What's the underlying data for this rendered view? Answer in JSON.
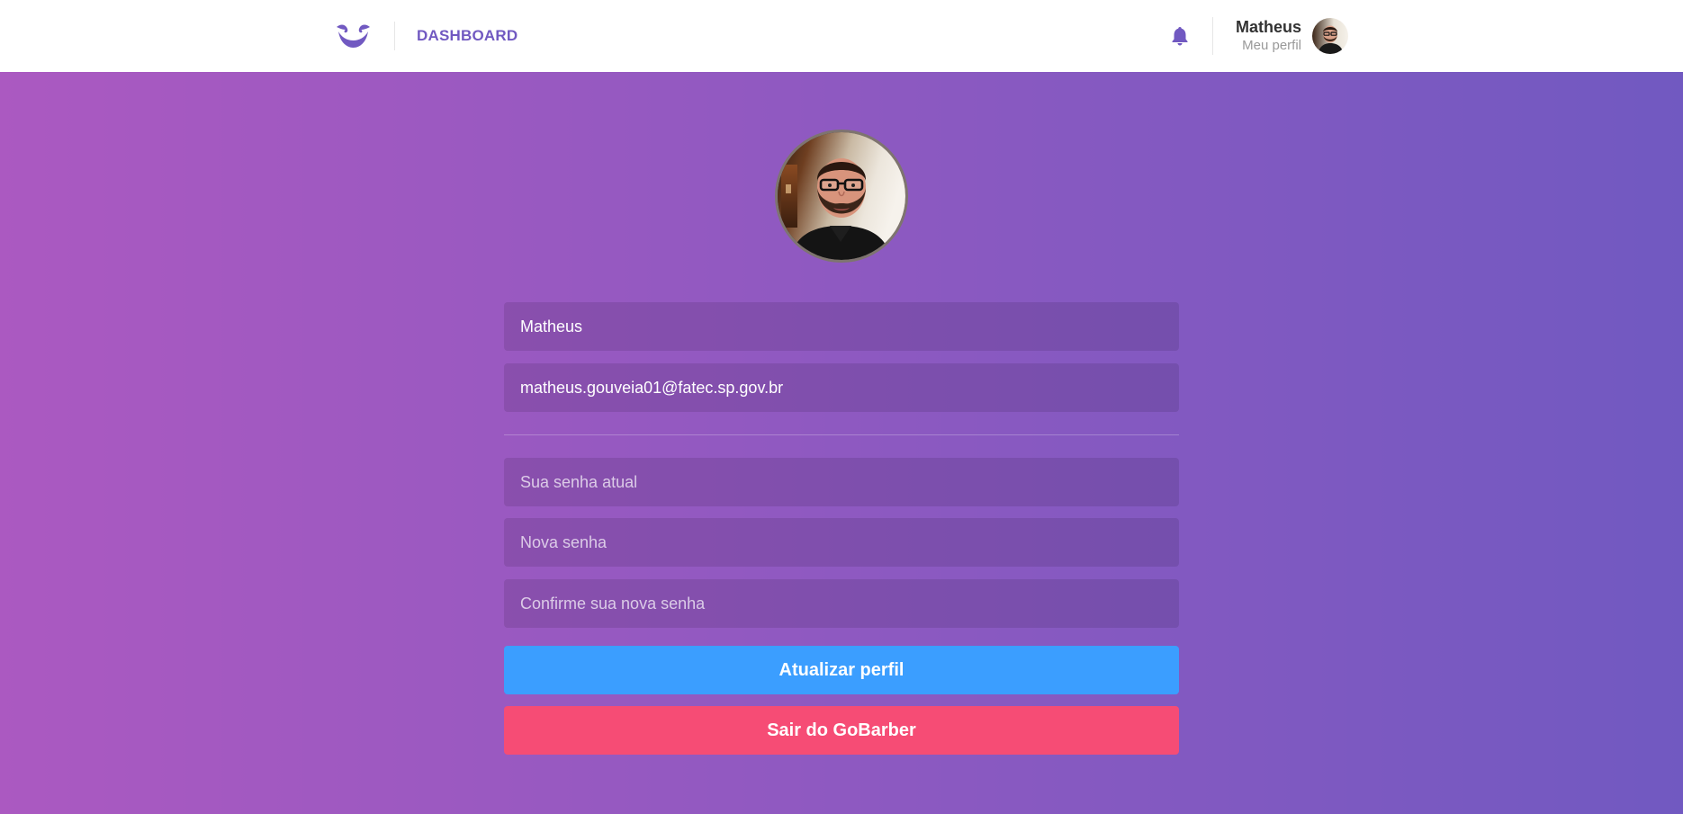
{
  "header": {
    "logo_icon": "gobarber-mustache-logo-icon",
    "nav_dashboard": "DASHBOARD",
    "notifications_icon": "bell-icon",
    "profile_name": "Matheus",
    "profile_link": "Meu perfil"
  },
  "profile_form": {
    "name_value": "Matheus",
    "email_value": "matheus.gouveia01@fatec.sp.gov.br",
    "old_password_placeholder": "Sua senha atual",
    "new_password_placeholder": "Nova senha",
    "confirm_password_placeholder": "Confirme sua nova senha",
    "submit_label": "Atualizar perfil",
    "logout_label": "Sair do GoBarber"
  },
  "colors": {
    "brand": "#7159c1",
    "gradient_start": "#ab59c1",
    "gradient_end": "#7159c1",
    "primary_button": "#3b9eff",
    "danger_button": "#f64c75"
  }
}
